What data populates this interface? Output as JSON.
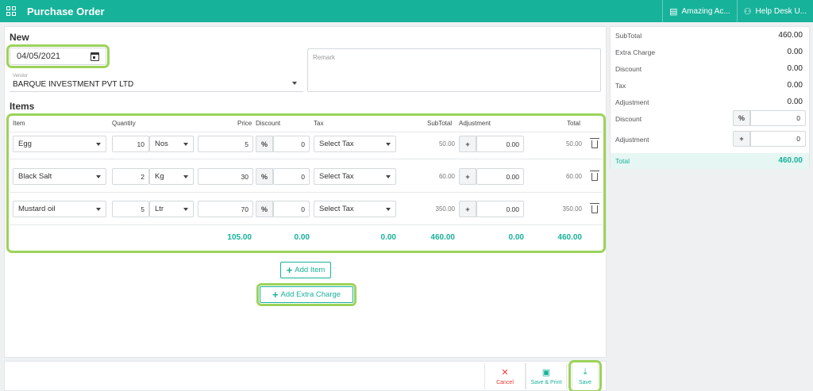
{
  "topbar": {
    "title": "Purchase Order",
    "company": "Amazing Ac...",
    "user": "Help Desk U..."
  },
  "form": {
    "heading": "New",
    "date": "04/05/2021",
    "vendor_label": "Vendor",
    "vendor_value": "BARQUE INVESTMENT PVT LTD",
    "remark_placeholder": "Remark"
  },
  "items": {
    "heading": "Items",
    "columns": [
      "Item",
      "Quantity",
      "Price",
      "Discount",
      "Tax",
      "SubTotal",
      "Adjustment",
      "Total"
    ],
    "rows": [
      {
        "item": "Egg",
        "qty": "10",
        "unit": "Nos",
        "price": "5",
        "disc_type": "%",
        "discount": "0",
        "tax": "Select Tax",
        "subtotal": "50.00",
        "adj_sign": "+",
        "adjustment": "0.00",
        "total": "50.00"
      },
      {
        "item": "Black Salt",
        "qty": "2",
        "unit": "Kg",
        "price": "30",
        "disc_type": "%",
        "discount": "0",
        "tax": "Select Tax",
        "subtotal": "60.00",
        "adj_sign": "+",
        "adjustment": "0.00",
        "total": "60.00"
      },
      {
        "item": "Mustard oil",
        "qty": "5",
        "unit": "Ltr",
        "price": "70",
        "disc_type": "%",
        "discount": "0",
        "tax": "Select Tax",
        "subtotal": "350.00",
        "adj_sign": "+",
        "adjustment": "0.00",
        "total": "350.00"
      }
    ],
    "totals": {
      "price": "105.00",
      "discount": "0.00",
      "tax": "0.00",
      "subtotal": "460.00",
      "adjustment": "0.00",
      "total": "460.00"
    }
  },
  "buttons": {
    "add_item": "Add Item",
    "add_extra_charge": "Add Extra Charge",
    "cancel": "Cancel",
    "save_print": "Save & Print",
    "save": "Save"
  },
  "summary": {
    "subtotal_label": "SubTotal",
    "subtotal": "460.00",
    "extra_label": "Extra Charge",
    "extra": "0.00",
    "discount_label": "Discount",
    "discount": "0.00",
    "tax_label": "Tax",
    "tax": "0.00",
    "adjustment_label": "Adjustment",
    "adjustment": "0.00",
    "discount_input_label": "Discount",
    "discount_input_type": "%",
    "discount_input": "0",
    "adjustment_input_label": "Adjustment",
    "adjustment_input_sign": "+",
    "adjustment_input": "0",
    "total_label": "Total",
    "total": "460.00"
  },
  "colors": {
    "brand": "#17b29a",
    "highlight": "#9bd35a",
    "cancel": "#e53935"
  }
}
